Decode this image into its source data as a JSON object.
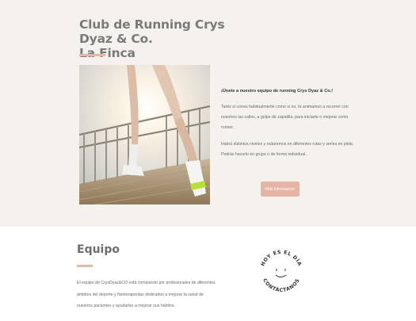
{
  "hero": {
    "title_line1": "Club de Running Crys Dyaz & Co.",
    "title_line2": "La Finca",
    "intro_heading": "¡Únete a nuestro equipo de running Crys Dyaz & Co.!",
    "intro_p1": "Tanto si corres habitualmente como si no, te animamos a recorrer con nosotros las calles, a golpe de zapatilla, para iniciarte o mejorar como runner.",
    "intro_p2": "Habrá distintos niveles y rodaremos en diferentes rutas y series en pista. Podrás hacerlo en grupo o de forma individual.",
    "button_label": "Más información"
  },
  "equipo": {
    "title": "Equipo",
    "text": "El equipo de CrysDyaz&CO está compuesto por profesionales de diferentes ámbitos del deporte y fisioterapeutas dedicados a mejorar la salud de nuestros pacientes y ayudarles a mejorar sus hábitos."
  },
  "badge": {
    "top_text": "HOY ES EL DÍA",
    "bottom_text": "CONTÁCTANOS"
  },
  "colors": {
    "accent": "#e6b4a4",
    "hero_bg": "#f5f2ee"
  }
}
